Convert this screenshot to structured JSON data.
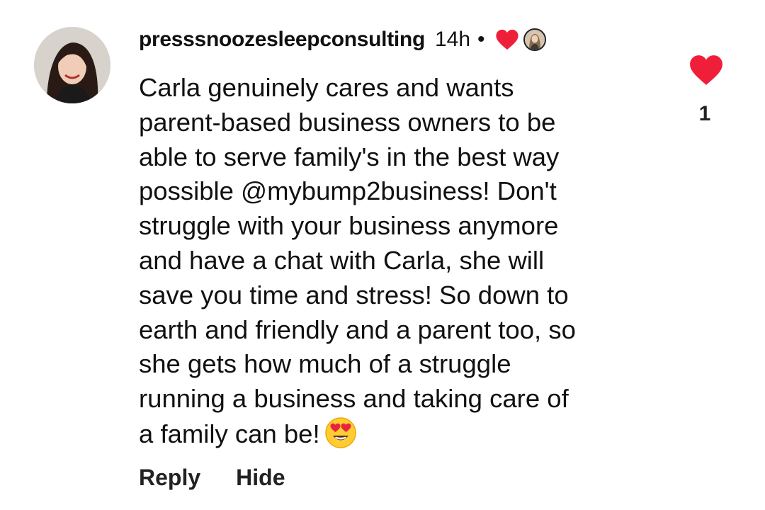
{
  "comment": {
    "username": "presssnoozesleepconsulting",
    "timestamp": "14h",
    "separator": "•",
    "lines": [
      "Carla genuinely cares and wants",
      "parent-based business owners to be",
      "able to serve family's in the best way",
      "possible @mybump2business! Don't",
      "struggle with your business anymore",
      "and have a chat with Carla, she will",
      "save you time and stress! So down to",
      "earth and friendly and a parent too, so",
      "she gets how much of a struggle",
      "running a business and taking care of",
      "a family can be!"
    ],
    "emoji": "heart-eyes-emoji",
    "actions": {
      "reply": "Reply",
      "hide": "Hide"
    },
    "like": {
      "count": "1",
      "icon": "heart-icon",
      "liked": true
    },
    "creator_liked_icon": "heart-icon"
  },
  "colors": {
    "heart": "#ef1f3a",
    "text": "#111111"
  }
}
